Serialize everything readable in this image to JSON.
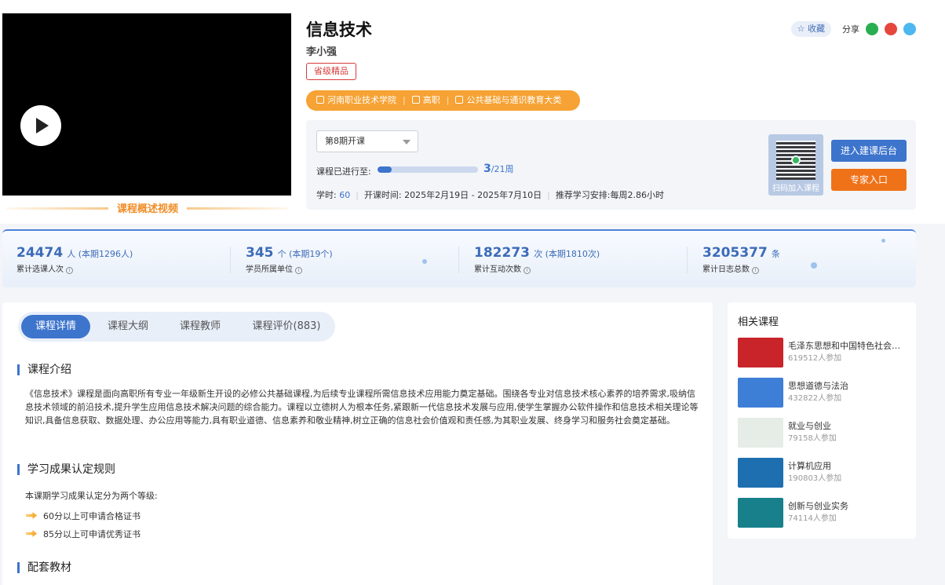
{
  "video": {
    "caption": "课程概述视频"
  },
  "course": {
    "title": "信息技术",
    "teacher": "李小强",
    "level_badge": "省级精品",
    "school": "河南职业技术学院",
    "level": "高职",
    "category": "公共基础与通识教育大类"
  },
  "actions": {
    "favorite_label": "收藏",
    "share_label": "分享"
  },
  "session": {
    "selected": "第8期开课",
    "progress_label": "课程已进行至:",
    "progress_current": "3",
    "progress_total": "/21周",
    "progress_fraction": 0.143,
    "hours_label": "学时:",
    "hours_value": "60",
    "dates": "开课时间: 2025年2月19日 - 2025年7月10日",
    "schedule": "推荐学习安排:每周2.86小时",
    "qr_label": "扫码加入课程",
    "backend_button": "进入建课后台",
    "expert_button": "专家入口"
  },
  "stats": [
    {
      "num": "24474",
      "unit": "人 (本期1296人)",
      "label": "累计选课人次"
    },
    {
      "num": "345",
      "unit": "个 (本期19个)",
      "label": "学员所属单位"
    },
    {
      "num": "182273",
      "unit": "次 (本期1810次)",
      "label": "累计互动次数"
    },
    {
      "num": "3205377",
      "unit": "条",
      "label": "累计日志总数"
    }
  ],
  "tabs": [
    "课程详情",
    "课程大纲",
    "课程教师",
    "课程评价(883)"
  ],
  "sections": {
    "intro_title": "课程介绍",
    "intro_text": "《信息技术》课程是面向高职所有专业一年级新生开设的必修公共基础课程,为后续专业课程所需信息技术应用能力奠定基础。围绕各专业对信息技术核心素养的培养需求,吸纳信息技术领域的前沿技术,提升学生应用信息技术解决问题的综合能力。课程以立德树人为根本任务,紧跟新一代信息技术发展与应用,使学生掌握办公软件操作和信息技术相关理论等知识,具备信息获取、数据处理、办公应用等能力,具有职业道德、信息素养和敬业精神,树立正确的信息社会价值观和责任感,为其职业发展、终身学习和服务社会奠定基础。",
    "rules_title": "学习成果认定规则",
    "rules_intro": "本课期学习成果认定分为两个等级:",
    "rules": [
      "60分以上可申请合格证书",
      "85分以上可申请优秀证书"
    ],
    "materials_title": "配套教材"
  },
  "related": {
    "title": "相关课程",
    "items": [
      {
        "name": "毛泽东思想和中国特色社会主义理论体系概论",
        "count": "619512人参加",
        "color": "#c8242a"
      },
      {
        "name": "思想道德与法治",
        "count": "432822人参加",
        "color": "#3d7ed6"
      },
      {
        "name": "就业与创业",
        "count": "79158人参加",
        "color": "#e6ece6"
      },
      {
        "name": "计算机应用",
        "count": "190803人参加",
        "color": "#1d6fb0"
      },
      {
        "name": "创新与创业实务",
        "count": "74114人参加",
        "color": "#17808a"
      }
    ]
  },
  "colors": {
    "primary": "#3d74cc",
    "orange": "#f6a234",
    "expert": "#ef7219",
    "badge": "#d83a3a"
  }
}
